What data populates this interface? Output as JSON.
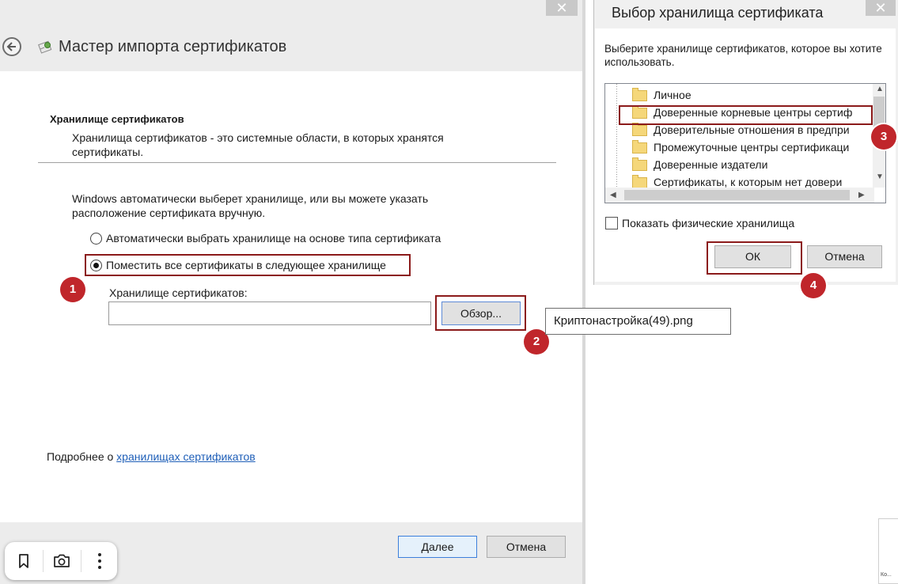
{
  "wizard": {
    "title": "Мастер импорта сертификатов",
    "close_symbol": "✕",
    "section_heading": "Хранилище сертификатов",
    "section_desc": "Хранилища сертификатов - это системные области, в которых хранятся сертификаты.",
    "auto_desc": "Windows автоматически выберет хранилище, или вы можете указать расположение сертификата вручную.",
    "radio_auto_label": "Автоматически выбрать хранилище на основе типа сертификата",
    "radio_place_label": "Поместить все сертификаты в следующее хранилище",
    "selected_option": "place",
    "store_label": "Хранилище сертификатов:",
    "store_value": "",
    "browse_label": "Обзор...",
    "more_info_prefix": "Подробнее о ",
    "more_info_link": "хранилищах сертификатов",
    "next_label": "Далее",
    "cancel_label": "Отмена"
  },
  "dialog": {
    "title": "Выбор хранилища сертификата",
    "close_symbol": "✕",
    "prompt": "Выберите хранилище сертификатов, которое вы хотите использовать.",
    "stores": [
      {
        "label": "Личное"
      },
      {
        "label": "Доверенные корневые центры сертиф"
      },
      {
        "label": "Доверительные отношения в предпри"
      },
      {
        "label": "Промежуточные центры сертификаци"
      },
      {
        "label": "Доверенные издатели"
      },
      {
        "label": "Сертификаты, к которым нет довери"
      }
    ],
    "highlighted_store": "Доверенные корневые центры сертиф",
    "show_physical_label": "Показать физические хранилища",
    "show_physical_checked": false,
    "ok_label": "ОК",
    "cancel_label": "Отмена"
  },
  "badges": [
    "1",
    "2",
    "3",
    "4"
  ],
  "tooltip": {
    "text": "Криптонастройка(49).png"
  },
  "toolbar": {
    "items": [
      "bookmark-icon",
      "camera-icon",
      "more-vertical-icon"
    ]
  },
  "corner": {
    "text": "Ко..."
  },
  "colors": {
    "highlight": "#8b1a1a",
    "badge": "#c0262b",
    "link": "#1f5fb8",
    "chrome": "#ececec"
  }
}
